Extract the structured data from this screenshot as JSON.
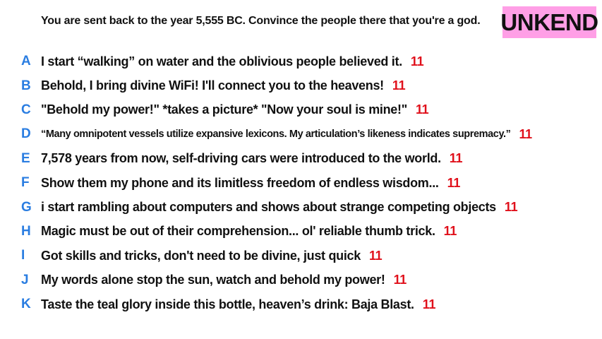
{
  "prompt": "You are sent back to the year 5,555 BC. Convince the people there that you're a god.",
  "logo": "UNKEND",
  "colors": {
    "letter": "#2a7de1",
    "score": "#e0101b",
    "logo_bg": "#ff9fe6"
  },
  "answers": [
    {
      "letter": "A",
      "text": "I start “walking” on water and the oblivious people believed it.",
      "score": "11"
    },
    {
      "letter": "B",
      "text": "Behold, I bring divine WiFi! I'll connect you to the heavens!",
      "score": "11"
    },
    {
      "letter": "C",
      "text": "\"Behold my power!\" *takes a picture* \"Now your soul is mine!\"",
      "score": "11"
    },
    {
      "letter": "D",
      "text": "“Many omnipotent vessels utilize expansive lexicons. My articulation’s likeness indicates supremacy.”",
      "score": "11"
    },
    {
      "letter": "E",
      "text": "7,578 years from now, self-driving cars were introduced to the world.",
      "score": "11"
    },
    {
      "letter": "F",
      "text": "Show them my phone and its limitless freedom of endless wisdom...",
      "score": "11"
    },
    {
      "letter": "G",
      "text": "i start rambling about computers and shows about strange competing objects",
      "score": "11"
    },
    {
      "letter": "H",
      "text": "Magic must be out of their comprehension... ol' reliable thumb trick.",
      "score": "11"
    },
    {
      "letter": "I",
      "text": "Got skills and tricks, don't need to be divine, just quick",
      "score": "11"
    },
    {
      "letter": "J",
      "text": "My words alone stop the sun, watch and behold my power!",
      "score": "11"
    },
    {
      "letter": "K",
      "text": "Taste the teal glory inside this bottle, heaven’s drink: Baja Blast.",
      "score": "11"
    }
  ]
}
